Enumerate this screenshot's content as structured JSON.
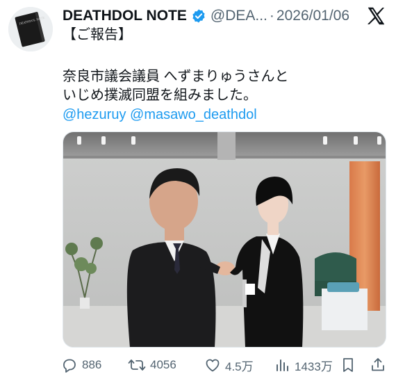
{
  "tweet": {
    "display_name": "DEATHDOL NOTE",
    "handle": "@DEA...",
    "dot": "·",
    "date": "2026/01/06",
    "avatar_text": "DEATHDOL NOTE",
    "lines": [
      "【ご報告】",
      "奈良市議会議員 へずまりゅうさんと",
      "いじめ撲滅同盟を組みました。"
    ],
    "mentions": [
      "@hezuruy",
      "@masawo_deathdol"
    ]
  },
  "actions": {
    "replies": "886",
    "reposts": "4056",
    "likes": "4.5万",
    "views": "1433万"
  },
  "colors": {
    "accent": "#1d9bf0",
    "muted": "#536471",
    "text": "#0f1419"
  },
  "icons": [
    "verified-badge-icon",
    "x-logo-icon",
    "reply-icon",
    "repost-icon",
    "like-icon",
    "views-icon",
    "bookmark-icon",
    "share-icon"
  ]
}
